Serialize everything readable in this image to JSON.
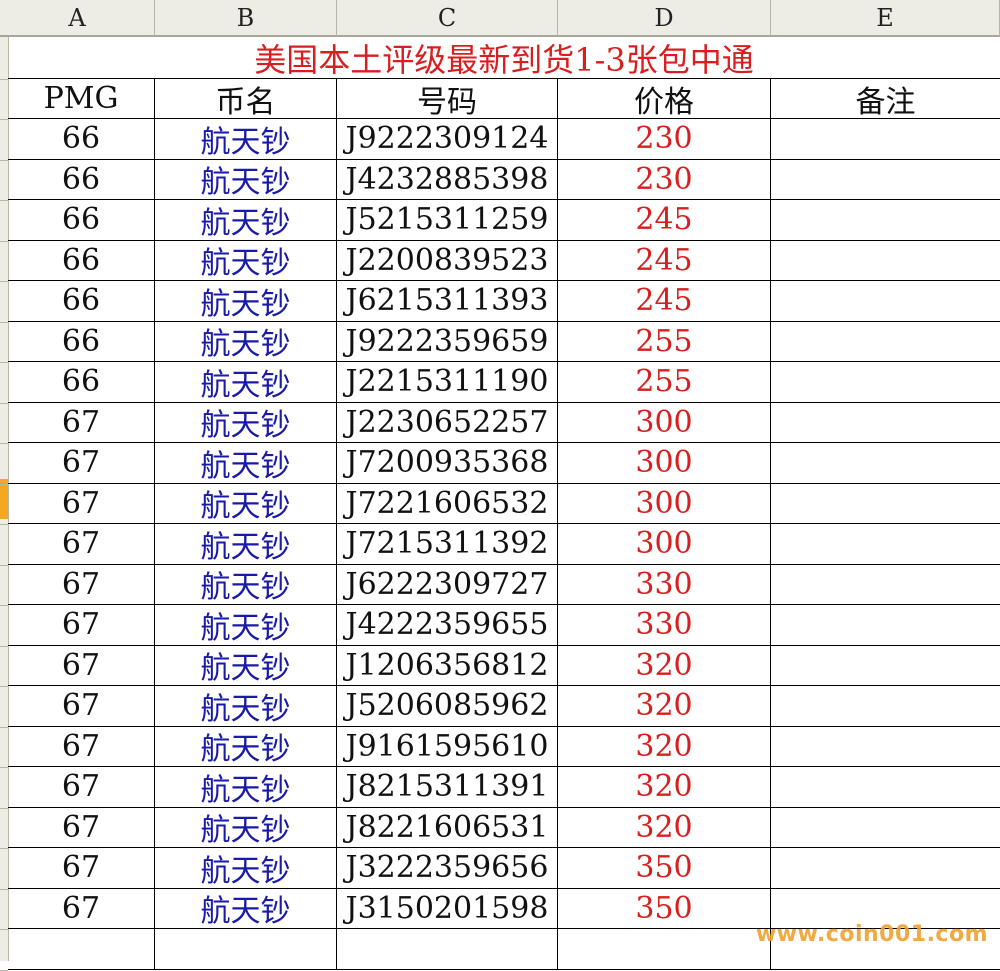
{
  "columns": [
    "A",
    "B",
    "C",
    "D",
    "E"
  ],
  "title": "美国本土评级最新到货1-3张包中通",
  "headers": [
    "PMG",
    "币名",
    "号码",
    "价格",
    "备注"
  ],
  "rows": [
    [
      "66",
      "航天钞",
      "J9222309124",
      "230",
      ""
    ],
    [
      "66",
      "航天钞",
      "J4232885398",
      "230",
      ""
    ],
    [
      "66",
      "航天钞",
      "J5215311259",
      "245",
      ""
    ],
    [
      "66",
      "航天钞",
      "J2200839523",
      "245",
      ""
    ],
    [
      "66",
      "航天钞",
      "J6215311393",
      "245",
      ""
    ],
    [
      "66",
      "航天钞",
      "J9222359659",
      "255",
      ""
    ],
    [
      "66",
      "航天钞",
      "J2215311190",
      "255",
      ""
    ],
    [
      "67",
      "航天钞",
      "J2230652257",
      "300",
      ""
    ],
    [
      "67",
      "航天钞",
      "J7200935368",
      "300",
      ""
    ],
    [
      "67",
      "航天钞",
      "J7221606532",
      "300",
      ""
    ],
    [
      "67",
      "航天钞",
      "J7215311392",
      "300",
      ""
    ],
    [
      "67",
      "航天钞",
      "J6222309727",
      "330",
      ""
    ],
    [
      "67",
      "航天钞",
      "J4222359655",
      "330",
      ""
    ],
    [
      "67",
      "航天钞",
      "J1206356812",
      "320",
      ""
    ],
    [
      "67",
      "航天钞",
      "J5206085962",
      "320",
      ""
    ],
    [
      "67",
      "航天钞",
      "J9161595610",
      "320",
      ""
    ],
    [
      "67",
      "航天钞",
      "J8215311391",
      "320",
      ""
    ],
    [
      "67",
      "航天钞",
      "J8221606531",
      "320",
      ""
    ],
    [
      "67",
      "航天钞",
      "J3222359656",
      "350",
      ""
    ],
    [
      "67",
      "航天钞",
      "J3150201598",
      "350",
      ""
    ],
    [
      "",
      "",
      "",
      "",
      ""
    ]
  ],
  "watermark": "www.coin001.com",
  "colors": {
    "title": "#d81e1e",
    "name": "#1a1aa8",
    "price": "#d81e1e",
    "selected_row_marker": "#f5a623"
  }
}
